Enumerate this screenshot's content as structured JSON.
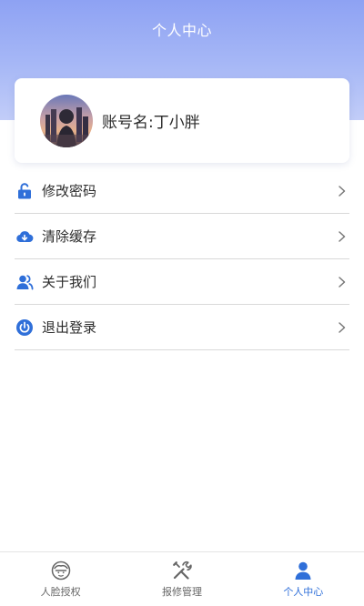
{
  "header": {
    "title": "个人中心"
  },
  "profile": {
    "account_label": "账号名:丁小胖",
    "avatar_icon": "avatar-photo"
  },
  "menu": {
    "items": [
      {
        "label": "修改密码",
        "icon": "unlock-icon"
      },
      {
        "label": "清除缓存",
        "icon": "cloud-download-icon"
      },
      {
        "label": "关于我们",
        "icon": "users-icon"
      },
      {
        "label": "退出登录",
        "icon": "power-icon"
      }
    ]
  },
  "tabbar": {
    "tabs": [
      {
        "label": "人脸授权",
        "icon": "face-icon",
        "active": false
      },
      {
        "label": "报修管理",
        "icon": "tools-icon",
        "active": false
      },
      {
        "label": "个人中心",
        "icon": "person-icon",
        "active": true
      }
    ]
  },
  "colors": {
    "accent": "#2f6fd9",
    "header_top": "#8ea2f3",
    "header_bottom": "#c2cdf8",
    "divider": "#d9d9d9"
  }
}
